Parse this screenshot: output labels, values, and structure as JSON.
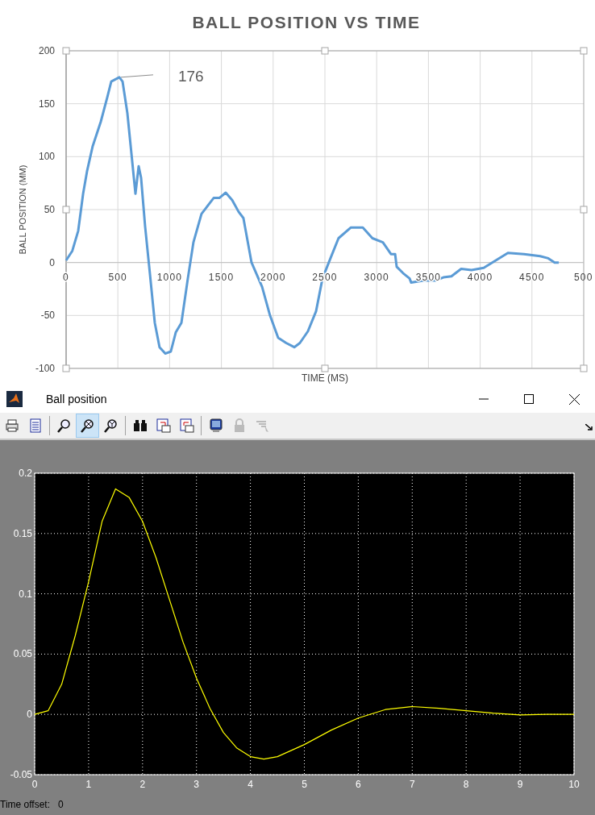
{
  "excel_chart": {
    "chart_data": {
      "type": "line",
      "title": "BALL POSITION VS TIME",
      "xlabel": "TIME (MS)",
      "ylabel": "BALL POSITION (MM)",
      "xlim": [
        0,
        5000
      ],
      "ylim": [
        -100,
        200
      ],
      "xticks": [
        0,
        500,
        1000,
        1500,
        2000,
        2500,
        3000,
        3500,
        4000,
        4500
      ],
      "yticks": [
        -100,
        -50,
        0,
        50,
        100,
        150,
        200
      ],
      "x": [
        0,
        60,
        117,
        164,
        202,
        257,
        335,
        397,
        436,
        514,
        545,
        592,
        631,
        670,
        701,
        724,
        763,
        810,
        857,
        903,
        958,
        1012,
        1059,
        1114,
        1176,
        1230,
        1308,
        1425,
        1480,
        1542,
        1604,
        1666,
        1713,
        1791,
        1893,
        1970,
        2048,
        2126,
        2204,
        2258,
        2336,
        2414,
        2477,
        2554,
        2632,
        2749,
        2866,
        2959,
        3060,
        3138,
        3178,
        3193,
        3255,
        3318,
        3333,
        3450,
        3567,
        3645,
        3722,
        3816,
        3917,
        4034,
        4151,
        4268,
        4424,
        4579,
        4657,
        4720,
        4759
      ],
      "grid": true,
      "series": [
        {
          "color": "#5b9bd5",
          "values": [
            2,
            11,
            30,
            65,
            86,
            110,
            133,
            156,
            171,
            175,
            171,
            141,
            103,
            65,
            91,
            80,
            34,
            -11,
            -57,
            -80,
            -86,
            -84,
            -66,
            -57,
            -15,
            19,
            46,
            61,
            61,
            66,
            59,
            48,
            42,
            0,
            -23,
            -50,
            -71,
            -76,
            -80,
            -76,
            -65,
            -46,
            -15,
            4,
            23,
            33,
            33,
            23,
            19,
            8,
            8,
            -4,
            -10,
            -15,
            -19,
            -17,
            -17,
            -14,
            -13,
            -6,
            -7,
            -5,
            2,
            9,
            8,
            6,
            4,
            0,
            0
          ]
        }
      ],
      "annotations": [
        "176"
      ]
    },
    "cut_tick_label": "500"
  },
  "scope_window": {
    "title": "Ball position",
    "toolbar": [
      {
        "kind": "print",
        "selected": false,
        "disabled": false
      },
      {
        "kind": "parameters",
        "selected": false,
        "disabled": false
      },
      {
        "kind": "separator"
      },
      {
        "kind": "zoom",
        "selected": false,
        "disabled": false
      },
      {
        "kind": "zoom-x",
        "selected": true,
        "disabled": false
      },
      {
        "kind": "zoom-y",
        "selected": false,
        "disabled": false
      },
      {
        "kind": "separator"
      },
      {
        "kind": "autoscale",
        "selected": false,
        "disabled": false
      },
      {
        "kind": "save-axes",
        "selected": false,
        "disabled": false
      },
      {
        "kind": "restore-axes",
        "selected": false,
        "disabled": false
      },
      {
        "kind": "separator"
      },
      {
        "kind": "float",
        "selected": false,
        "disabled": false
      },
      {
        "kind": "lock",
        "selected": false,
        "disabled": true
      },
      {
        "kind": "signal-select",
        "selected": false,
        "disabled": true
      }
    ],
    "chart_data": {
      "type": "line",
      "xlim": [
        0,
        10
      ],
      "ylim": [
        -0.05,
        0.2
      ],
      "xticks": [
        0,
        1,
        2,
        3,
        4,
        5,
        6,
        7,
        8,
        9,
        10
      ],
      "yticks": [
        -0.05,
        0,
        0.05,
        0.1,
        0.15,
        0.2
      ],
      "x": [
        0,
        0.25,
        0.5,
        0.75,
        1,
        1.25,
        1.5,
        1.75,
        2,
        2.25,
        2.5,
        2.75,
        3,
        3.25,
        3.5,
        3.75,
        4,
        4.25,
        4.5,
        5,
        5.5,
        6,
        6.5,
        7,
        7.5,
        8,
        8.5,
        9,
        9.5,
        10
      ],
      "grid": true,
      "series": [
        {
          "color": "#ffff00",
          "values": [
            0,
            0.003,
            0.025,
            0.065,
            0.11,
            0.16,
            0.187,
            0.18,
            0.16,
            0.13,
            0.095,
            0.06,
            0.03,
            0.005,
            -0.015,
            -0.028,
            -0.035,
            -0.037,
            -0.035,
            -0.025,
            -0.013,
            -0.003,
            0.004,
            0.0065,
            0.005,
            0.003,
            0.001,
            -0.0005,
            0,
            0
          ]
        }
      ]
    },
    "time_offset": {
      "label": "Time offset:",
      "value": "0"
    }
  }
}
